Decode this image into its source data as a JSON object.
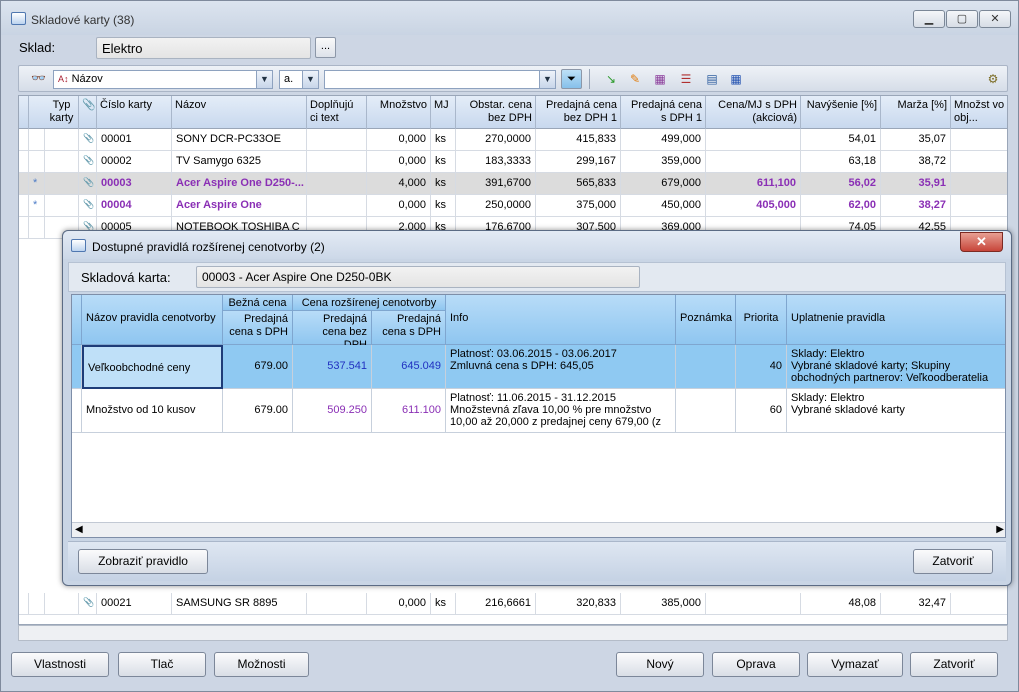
{
  "window": {
    "title": "Skladové karty (38)",
    "min": "▁",
    "max": "▢",
    "close": "✕"
  },
  "sklad": {
    "label": "Sklad:",
    "value": "Elektro",
    "browse": "..."
  },
  "toolbar": {
    "field_select": "Názov",
    "mode_select": "a.",
    "search_value": ""
  },
  "grid": {
    "headers": [
      "Typ karty",
      "",
      "Číslo karty",
      "Názov",
      "Doplňujú ci text",
      "Množstvo",
      "MJ",
      "Obstar. cena bez DPH",
      "Predajná cena bez DPH 1",
      "Predajná cena s DPH 1",
      "Cena/MJ s DPH (akciová)",
      "Navýšenie [%]",
      "Marža [%]",
      "Množst vo obj..."
    ],
    "rows": [
      {
        "star": "",
        "cislo": "00001",
        "nazov": "SONY DCR-PC33OE",
        "mnozstvo": "0,000",
        "mj": "ks",
        "obstar": "270,0000",
        "pred_bez": "415,833",
        "pred_s": "499,000",
        "akc": "",
        "navys": "54,01",
        "marza": "35,07"
      },
      {
        "star": "",
        "cislo": "00002",
        "nazov": "TV Samygo 6325",
        "mnozstvo": "0,000",
        "mj": "ks",
        "obstar": "183,3333",
        "pred_bez": "299,167",
        "pred_s": "359,000",
        "akc": "",
        "navys": "63,18",
        "marza": "38,72"
      },
      {
        "star": "*",
        "cislo": "00003",
        "nazov": "Acer Aspire One D250-...",
        "mnozstvo": "4,000",
        "mj": "ks",
        "obstar": "391,6700",
        "pred_bez": "565,833",
        "pred_s": "679,000",
        "akc": "611,100",
        "navys": "56,02",
        "marza": "35,91"
      },
      {
        "star": "*",
        "cislo": "00004",
        "nazov": "Acer Aspire One",
        "mnozstvo": "0,000",
        "mj": "ks",
        "obstar": "250,0000",
        "pred_bez": "375,000",
        "pred_s": "450,000",
        "akc": "405,000",
        "navys": "62,00",
        "marza": "38,27"
      },
      {
        "star": "",
        "cislo": "00005",
        "nazov": "NOTEBOOK TOSHIBA C",
        "mnozstvo": "2,000",
        "mj": "ks",
        "obstar": "176,6700",
        "pred_bez": "307,500",
        "pred_s": "369,000",
        "akc": "",
        "navys": "74,05",
        "marza": "42,55"
      }
    ],
    "bottom_rows": [
      {
        "cislo": "00021",
        "nazov": "SAMSUNG SR 8895",
        "mnozstvo": "0,000",
        "mj": "ks",
        "obstar": "216,6661",
        "pred_bez": "320,833",
        "pred_s": "385,000",
        "navys": "48,08",
        "marza": "32,47"
      }
    ]
  },
  "buttons": {
    "vlastnosti": "Vlastnosti",
    "tlac": "Tlač",
    "moznosti": "Možnosti",
    "novy": "Nový",
    "oprava": "Oprava",
    "vymazat": "Vymazať",
    "zatvorit": "Zatvoriť"
  },
  "dialog": {
    "title": "Dostupné pravidlá rozšírenej cenotvorby (2)",
    "card_label": "Skladová karta:",
    "card_value": "00003 - Acer Aspire One D250-0BK",
    "headers": {
      "nazov": "Názov pravidla cenotvorby",
      "bezna": "Bežná cena",
      "rozsirena": "Cena rozšírenej cenotvorby",
      "pred_s": "Predajná cena s DPH",
      "pred_bez": "Predajná cena bez DPH",
      "pred_s2": "Predajná cena s DPH",
      "info": "Info",
      "poznamka": "Poznámka",
      "priorita": "Priorita",
      "uplatnenie": "Uplatnenie pravidla"
    },
    "rows": [
      {
        "nazov": "Veľkoobchodné ceny",
        "bezna": "679.00",
        "bez": "537.541",
        "s": "645.049",
        "info1": "Platnosť: 03.06.2015 - 03.06.2017",
        "info2": "Zmluvná cena s DPH: 645,05",
        "info3": "",
        "priorita": "40",
        "upl1": "Sklady: Elektro",
        "upl2": "Vybrané skladové karty; Skupiny",
        "upl3": "obchodných partnerov: Veľkoodberatelia"
      },
      {
        "nazov": "Množstvo od 10 kusov",
        "bezna": "679.00",
        "bez": "509.250",
        "s": "611.100",
        "info1": "Platnosť: 11.06.2015 - 31.12.2015",
        "info2": "Množstevná zľava 10,00 % pre množstvo",
        "info3": "10,00 až 20,000 z predajnej ceny 679,00 (z",
        "priorita": "60",
        "upl1": "Sklady: Elektro",
        "upl2": "Vybrané skladové karty",
        "upl3": ""
      }
    ],
    "btn_zobrazit": "Zobraziť pravidlo",
    "btn_zatvorit": "Zatvoriť"
  }
}
